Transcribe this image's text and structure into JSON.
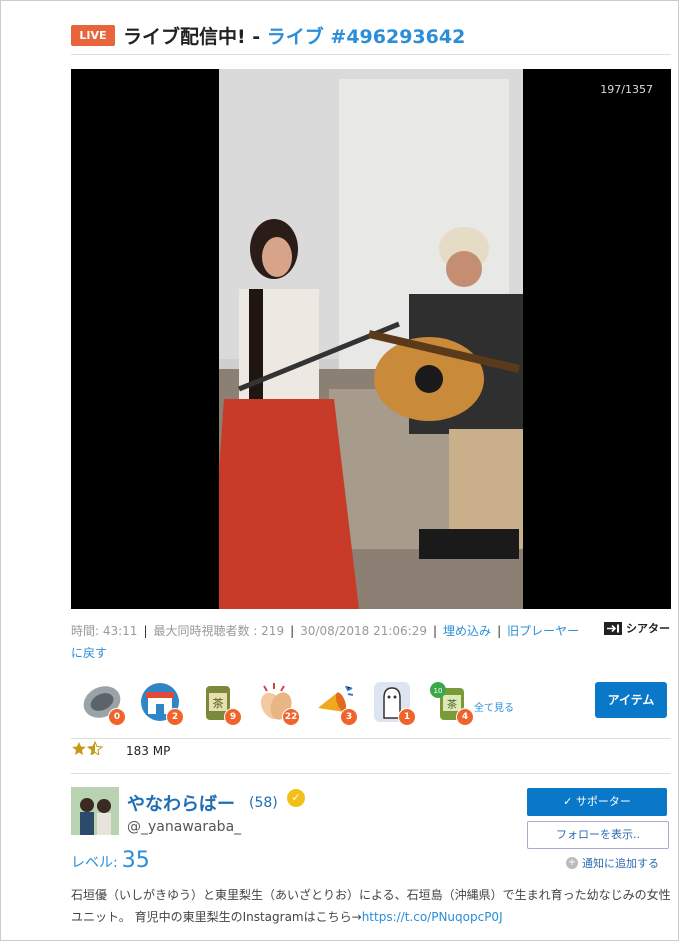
{
  "header": {
    "live_badge": "LIVE",
    "title_prefix": "ライブ配信中! - ",
    "title_link": "ライブ #496293642"
  },
  "video": {
    "viewers": "197/1357"
  },
  "meta": {
    "time": "時間: 43:11",
    "max_viewers": "最大同時視聴者数 : 219",
    "datetime": "30/08/2018 21:06:29",
    "embed_link": "埋め込み",
    "old_player_link": "旧プレーヤーに戻す",
    "theater": "シアター"
  },
  "items": [
    {
      "name": "coin",
      "count": "0"
    },
    {
      "name": "shop",
      "count": "2"
    },
    {
      "name": "tea-can",
      "count": "9"
    },
    {
      "name": "clap",
      "count": "22"
    },
    {
      "name": "megaphone",
      "count": "3"
    },
    {
      "name": "ghost",
      "count": "1"
    },
    {
      "name": "tea-x10",
      "count": "4"
    }
  ],
  "see_all": "全て見る",
  "item_button": "アイテム",
  "rating": {
    "stars": 1.5,
    "mp": "183 MP"
  },
  "user": {
    "name": "やなわらばー",
    "count": "(58)",
    "handle": "@_yanawaraba_",
    "level_label": "レベル:",
    "level_value": "35"
  },
  "buttons": {
    "supporter": "✓ サポーター",
    "follow": "フォローを表示..",
    "notify": "通知に追加する"
  },
  "description": {
    "text": "石垣優（いしがきゆう）と東里梨生（あいざとりお）による、石垣島（沖縄県）で生まれ育った幼なじみの女性ユニット。 育児中の東里梨生のInstagramはこちら→",
    "link": "https://t.co/PNuqopcP0J"
  },
  "colors": {
    "accent": "#2b8ed8",
    "live": "#e8653b",
    "button": "#0a78c8"
  }
}
